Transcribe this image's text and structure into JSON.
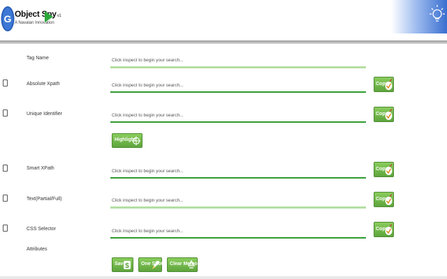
{
  "header": {
    "logo_letter": "G",
    "title": "Object Spy",
    "version": "v1",
    "subtitle": "A Navalan Innovation"
  },
  "colors": {
    "accent_green": "#5ea53d",
    "field_line": "#2f9a2f",
    "field_line_light": "#b3dfa3",
    "logo_blue": "#2a5fb8",
    "header_deco_blue": "#3a6fd0"
  },
  "icons": {
    "logo": "g-globe-logo",
    "logo_arrow": "play-arrow-icon",
    "corner": "lightbulb-icon",
    "copy": "pencil-check-icon",
    "highlight": "crosshair-icon",
    "save": "dollar-icon",
    "one_shot": "rocket-icon",
    "clear_memory": "recycle-icon"
  },
  "fields": [
    {
      "label": "Tag Name",
      "value": "Click inspect to begin your search...",
      "checkbox": false,
      "copy": false
    },
    {
      "label": "Absolute Xpath",
      "value": "Click inspect to begin your search...",
      "checkbox": true,
      "copy": true,
      "copy_label": "Copy"
    },
    {
      "label": "Unique Identifier",
      "value": "Click inspect to begin your search...",
      "checkbox": true,
      "copy": true,
      "copy_label": "Copy"
    },
    {
      "label": "Smart XPath",
      "value": "Click inspect to begin your search...",
      "checkbox": true,
      "copy": true,
      "copy_label": "Copy"
    },
    {
      "label": "Text(Partial/Full)",
      "value": "Click inspect to begin your search...",
      "checkbox": true,
      "copy": true,
      "copy_label": "Copy"
    },
    {
      "label": "CSS Selector",
      "value": "Click inspect to begin your search...",
      "checkbox": true,
      "copy": true,
      "copy_label": "Copy"
    }
  ],
  "highlight_label": "Highlight",
  "attributes_label": "Attributes",
  "actions": {
    "save_label": "Save",
    "one_shot_label": "One Shot",
    "clear_memory_label": "Clear Memory"
  }
}
